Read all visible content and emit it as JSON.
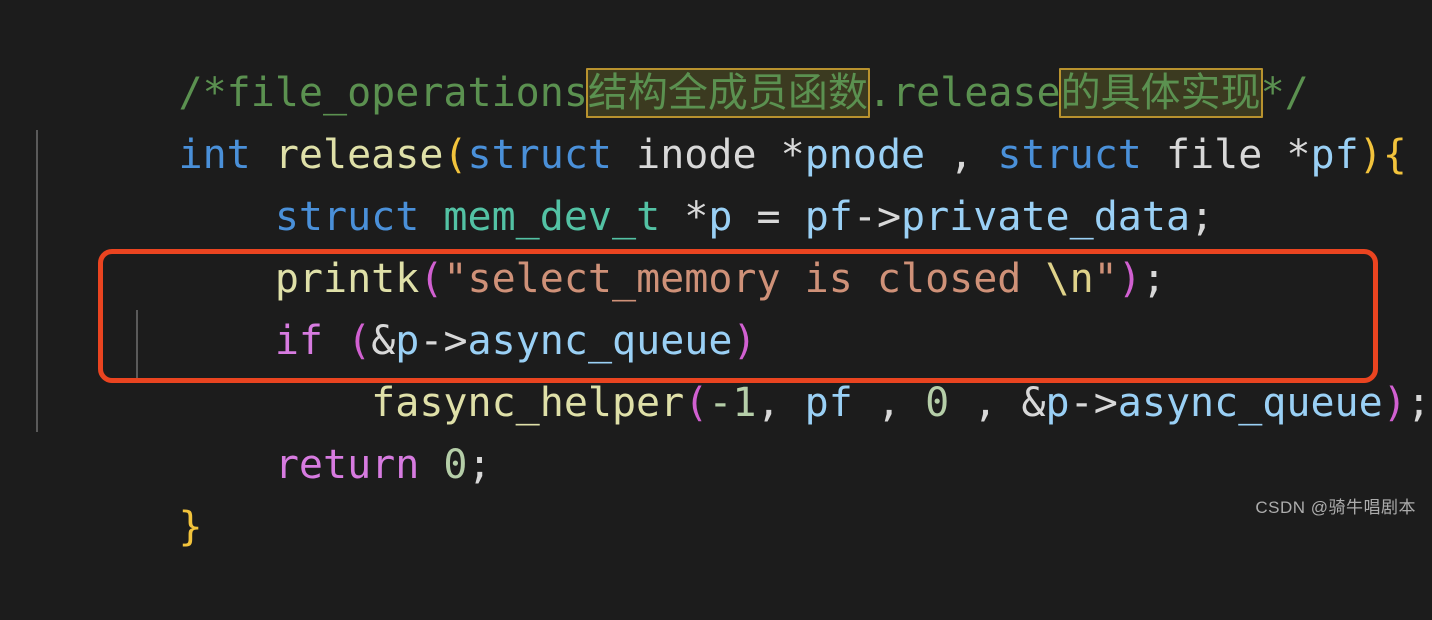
{
  "editor": {
    "background_color": "#1c1c1c",
    "language": "c",
    "annotation": {
      "red_box_color": "#ea4420",
      "highlight_bg_color": "#3b3a20",
      "highlight_border_color": "#b8922e"
    }
  },
  "code": {
    "line1": {
      "comment_open": "/*file_operations",
      "highlight_1": "结构全成员函数",
      "middle": ".release",
      "highlight_2": "的具体实现",
      "comment_close": "*/"
    },
    "line2": {
      "kw_int": "int",
      "space1": " ",
      "fn_release": "release",
      "paren_open": "(",
      "kw_struct1": "struct",
      "space2": " ",
      "type_inode": "inode",
      "space3": " ",
      "star_pnode": "*",
      "var_pnode": "pnode",
      "comma": " , ",
      "kw_struct2": "struct",
      "space4": " ",
      "type_file": "file",
      "space5": " ",
      "star_pf": "*",
      "var_pf": "pf",
      "paren_close": ")",
      "brace_open": "{"
    },
    "line3": {
      "indent": "    ",
      "kw_struct": "struct",
      "space1": " ",
      "type_mem_dev_t": "mem_dev_t",
      "space2": " ",
      "star": "*",
      "var_p": "p",
      "assign": " = ",
      "var_pf": "pf",
      "arrow": "->",
      "var_private_data": "private_data",
      "semi": ";"
    },
    "line4": {
      "indent": "    ",
      "fn_printk": "printk",
      "paren_open": "(",
      "string_part": "\"select_memory is closed ",
      "escape": "\\n",
      "string_end": "\"",
      "paren_close": ")",
      "semi": ";"
    },
    "line5": {
      "indent": "    ",
      "kw_if": "if",
      "space": " ",
      "paren_open": "(",
      "amp": "&",
      "var_p": "p",
      "arrow": "->",
      "var_async_queue": "async_queue",
      "paren_close": ")"
    },
    "line6": {
      "indent": "        ",
      "fn_fasync_helper": "fasync_helper",
      "paren_open": "(",
      "num_minus1": "-1",
      "comma1": ", ",
      "var_pf": "pf",
      "comma2": " , ",
      "num_0": "0",
      "comma3": " , ",
      "amp": "&",
      "var_p": "p",
      "arrow": "->",
      "var_async_queue": "async_queue",
      "paren_close": ")",
      "semi": ";"
    },
    "line7": {
      "indent": "    ",
      "kw_return": "return",
      "space": " ",
      "num_0": "0",
      "semi": ";"
    },
    "line8": {
      "brace_close": "}"
    }
  },
  "watermark": {
    "text": "CSDN @骑牛唱剧本"
  }
}
